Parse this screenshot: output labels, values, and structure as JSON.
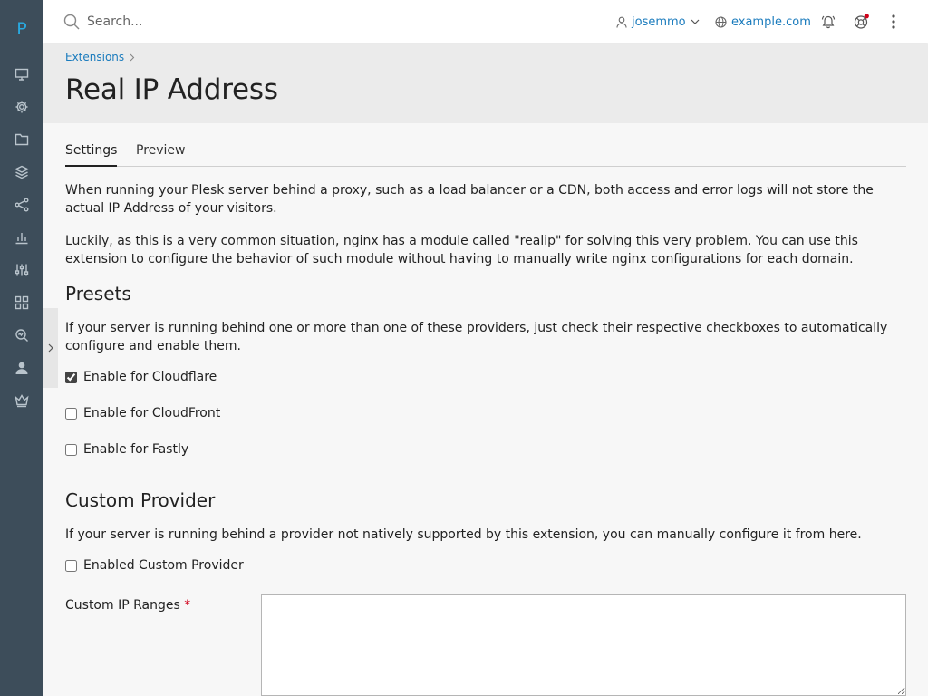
{
  "sidebar": {
    "logo": "P",
    "items": [
      {
        "name": "websites-domains",
        "icon": "monitor-icon"
      },
      {
        "name": "tools-settings",
        "icon": "gear-icon"
      },
      {
        "name": "files",
        "icon": "folder-icon"
      },
      {
        "name": "applications",
        "icon": "stack-icon"
      },
      {
        "name": "sharing",
        "icon": "share-icon"
      },
      {
        "name": "statistics",
        "icon": "bar-chart-icon"
      },
      {
        "name": "tools",
        "icon": "sliders-icon"
      },
      {
        "name": "extensions",
        "icon": "grid-icon"
      },
      {
        "name": "monitoring",
        "icon": "magnifier-icon"
      },
      {
        "name": "account",
        "icon": "user-icon"
      },
      {
        "name": "advisor",
        "icon": "crown-icon"
      }
    ]
  },
  "topbar": {
    "search_placeholder": "Search...",
    "user": "josemmo",
    "domain": "example.com"
  },
  "header": {
    "breadcrumb": "Extensions",
    "title": "Real IP Address"
  },
  "tabs": [
    {
      "label": "Settings",
      "active": true
    },
    {
      "label": "Preview",
      "active": false
    }
  ],
  "intro": {
    "p1": "When running your Plesk server behind a proxy, such as a load balancer or a CDN, both access and error logs will not store the actual IP Address of your visitors.",
    "p2": "Luckily, as this is a very common situation, nginx has a module called \"realip\" for solving this very problem. You can use this extension to configure the behavior of such module without having to manually write nginx configurations for each domain."
  },
  "presets": {
    "title": "Presets",
    "description": "If your server is running behind one or more than one of these providers, just check their respective checkboxes to automatically configure and enable them.",
    "options": [
      {
        "label": "Enable for Cloudflare",
        "checked": true
      },
      {
        "label": "Enable for CloudFront",
        "checked": false
      },
      {
        "label": "Enable for Fastly",
        "checked": false
      }
    ]
  },
  "custom": {
    "title": "Custom Provider",
    "description": "If your server is running behind a provider not natively supported by this extension, you can manually configure it from here.",
    "enable_label": "Enabled Custom Provider",
    "enable_checked": false,
    "ranges_label": "Custom IP Ranges",
    "required_mark": "*",
    "ranges_value": ""
  },
  "colors": {
    "sidebar": "#3d4d5a",
    "accent": "#1a7bbd",
    "logo": "#29a9df",
    "header_band": "#ebebeb",
    "notification_dot": "#d0021b"
  }
}
